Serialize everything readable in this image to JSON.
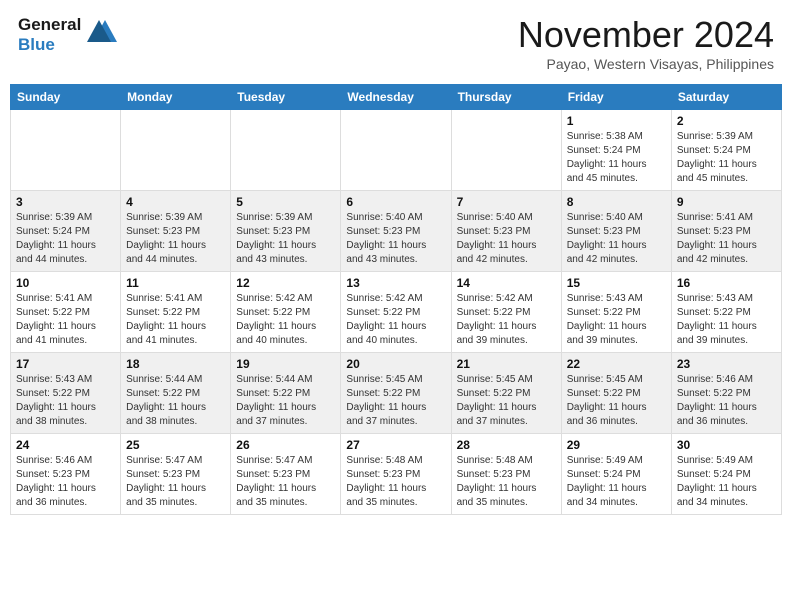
{
  "header": {
    "logo_line1": "General",
    "logo_line2": "Blue",
    "month_title": "November 2024",
    "subtitle": "Payao, Western Visayas, Philippines"
  },
  "weekdays": [
    "Sunday",
    "Monday",
    "Tuesday",
    "Wednesday",
    "Thursday",
    "Friday",
    "Saturday"
  ],
  "weeks": [
    [
      {
        "day": "",
        "info": ""
      },
      {
        "day": "",
        "info": ""
      },
      {
        "day": "",
        "info": ""
      },
      {
        "day": "",
        "info": ""
      },
      {
        "day": "",
        "info": ""
      },
      {
        "day": "1",
        "info": "Sunrise: 5:38 AM\nSunset: 5:24 PM\nDaylight: 11 hours\nand 45 minutes."
      },
      {
        "day": "2",
        "info": "Sunrise: 5:39 AM\nSunset: 5:24 PM\nDaylight: 11 hours\nand 45 minutes."
      }
    ],
    [
      {
        "day": "3",
        "info": "Sunrise: 5:39 AM\nSunset: 5:24 PM\nDaylight: 11 hours\nand 44 minutes."
      },
      {
        "day": "4",
        "info": "Sunrise: 5:39 AM\nSunset: 5:23 PM\nDaylight: 11 hours\nand 44 minutes."
      },
      {
        "day": "5",
        "info": "Sunrise: 5:39 AM\nSunset: 5:23 PM\nDaylight: 11 hours\nand 43 minutes."
      },
      {
        "day": "6",
        "info": "Sunrise: 5:40 AM\nSunset: 5:23 PM\nDaylight: 11 hours\nand 43 minutes."
      },
      {
        "day": "7",
        "info": "Sunrise: 5:40 AM\nSunset: 5:23 PM\nDaylight: 11 hours\nand 42 minutes."
      },
      {
        "day": "8",
        "info": "Sunrise: 5:40 AM\nSunset: 5:23 PM\nDaylight: 11 hours\nand 42 minutes."
      },
      {
        "day": "9",
        "info": "Sunrise: 5:41 AM\nSunset: 5:23 PM\nDaylight: 11 hours\nand 42 minutes."
      }
    ],
    [
      {
        "day": "10",
        "info": "Sunrise: 5:41 AM\nSunset: 5:22 PM\nDaylight: 11 hours\nand 41 minutes."
      },
      {
        "day": "11",
        "info": "Sunrise: 5:41 AM\nSunset: 5:22 PM\nDaylight: 11 hours\nand 41 minutes."
      },
      {
        "day": "12",
        "info": "Sunrise: 5:42 AM\nSunset: 5:22 PM\nDaylight: 11 hours\nand 40 minutes."
      },
      {
        "day": "13",
        "info": "Sunrise: 5:42 AM\nSunset: 5:22 PM\nDaylight: 11 hours\nand 40 minutes."
      },
      {
        "day": "14",
        "info": "Sunrise: 5:42 AM\nSunset: 5:22 PM\nDaylight: 11 hours\nand 39 minutes."
      },
      {
        "day": "15",
        "info": "Sunrise: 5:43 AM\nSunset: 5:22 PM\nDaylight: 11 hours\nand 39 minutes."
      },
      {
        "day": "16",
        "info": "Sunrise: 5:43 AM\nSunset: 5:22 PM\nDaylight: 11 hours\nand 39 minutes."
      }
    ],
    [
      {
        "day": "17",
        "info": "Sunrise: 5:43 AM\nSunset: 5:22 PM\nDaylight: 11 hours\nand 38 minutes."
      },
      {
        "day": "18",
        "info": "Sunrise: 5:44 AM\nSunset: 5:22 PM\nDaylight: 11 hours\nand 38 minutes."
      },
      {
        "day": "19",
        "info": "Sunrise: 5:44 AM\nSunset: 5:22 PM\nDaylight: 11 hours\nand 37 minutes."
      },
      {
        "day": "20",
        "info": "Sunrise: 5:45 AM\nSunset: 5:22 PM\nDaylight: 11 hours\nand 37 minutes."
      },
      {
        "day": "21",
        "info": "Sunrise: 5:45 AM\nSunset: 5:22 PM\nDaylight: 11 hours\nand 37 minutes."
      },
      {
        "day": "22",
        "info": "Sunrise: 5:45 AM\nSunset: 5:22 PM\nDaylight: 11 hours\nand 36 minutes."
      },
      {
        "day": "23",
        "info": "Sunrise: 5:46 AM\nSunset: 5:22 PM\nDaylight: 11 hours\nand 36 minutes."
      }
    ],
    [
      {
        "day": "24",
        "info": "Sunrise: 5:46 AM\nSunset: 5:23 PM\nDaylight: 11 hours\nand 36 minutes."
      },
      {
        "day": "25",
        "info": "Sunrise: 5:47 AM\nSunset: 5:23 PM\nDaylight: 11 hours\nand 35 minutes."
      },
      {
        "day": "26",
        "info": "Sunrise: 5:47 AM\nSunset: 5:23 PM\nDaylight: 11 hours\nand 35 minutes."
      },
      {
        "day": "27",
        "info": "Sunrise: 5:48 AM\nSunset: 5:23 PM\nDaylight: 11 hours\nand 35 minutes."
      },
      {
        "day": "28",
        "info": "Sunrise: 5:48 AM\nSunset: 5:23 PM\nDaylight: 11 hours\nand 35 minutes."
      },
      {
        "day": "29",
        "info": "Sunrise: 5:49 AM\nSunset: 5:24 PM\nDaylight: 11 hours\nand 34 minutes."
      },
      {
        "day": "30",
        "info": "Sunrise: 5:49 AM\nSunset: 5:24 PM\nDaylight: 11 hours\nand 34 minutes."
      }
    ]
  ]
}
